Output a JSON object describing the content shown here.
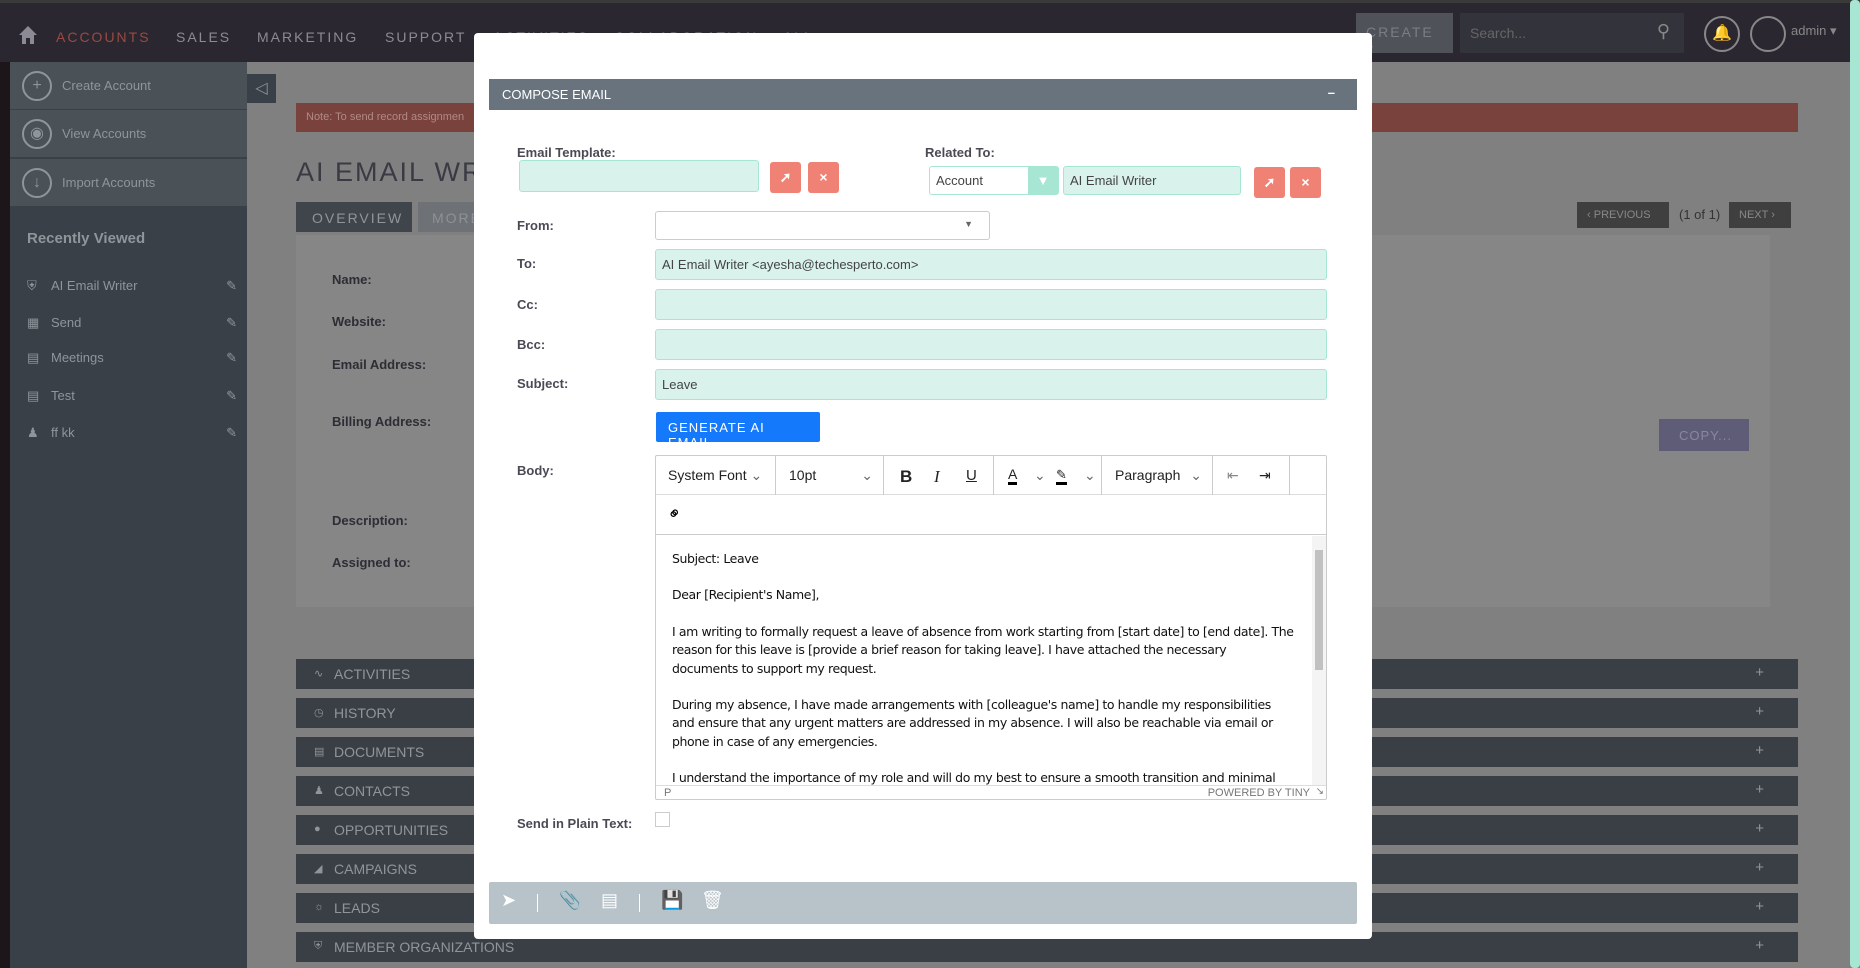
{
  "nav": {
    "items": [
      "ACCOUNTS",
      "SALES",
      "MARKETING",
      "SUPPORT",
      "ACTIVITIES",
      "COLLABORATION",
      "ALL"
    ],
    "create": "CREATE",
    "search_placeholder": "Search...",
    "user": "admin"
  },
  "sidebar": {
    "actions": [
      "Create Account",
      "View Accounts",
      "Import Accounts"
    ],
    "recent_title": "Recently Viewed",
    "recent": [
      "AI Email Writer",
      "Send",
      "Meetings",
      "Test",
      "ff kk"
    ]
  },
  "page": {
    "note": "Note: To send record assignmen",
    "title": "AI EMAIL WR",
    "tabs": [
      "OVERVIEW",
      "MORE"
    ],
    "labels": [
      "Name:",
      "Website:",
      "Email Address:",
      "Billing Address:",
      "Description:",
      "Assigned to:"
    ],
    "prev": "PREVIOUS",
    "count": "(1 of 1)",
    "next": "NEXT",
    "copy": "COPY...",
    "panels": [
      "ACTIVITIES",
      "HISTORY",
      "DOCUMENTS",
      "CONTACTS",
      "OPPORTUNITIES",
      "CAMPAIGNS",
      "LEADS",
      "MEMBER ORGANIZATIONS"
    ]
  },
  "modal": {
    "title": "COMPOSE EMAIL",
    "minimize": "–",
    "email_template_label": "Email Template:",
    "email_template_value": "",
    "related_label": "Related To:",
    "related_type": "Account",
    "related_value": "AI Email Writer",
    "from_label": "From:",
    "from_value": "",
    "to_label": "To:",
    "to_value": "AI Email Writer <ayesha@techesperto.com>",
    "cc_label": "Cc:",
    "cc_value": "",
    "bcc_label": "Bcc:",
    "bcc_value": "",
    "subject_label": "Subject:",
    "subject_value": "Leave",
    "generate": "GENERATE AI EMAIL",
    "body_label": "Body:",
    "plain_label": "Send in Plain Text:",
    "plain_checked": false,
    "editor": {
      "font": "System Font",
      "size": "10pt",
      "block": "Paragraph",
      "status_path": "P",
      "powered": "POWERED BY TINY",
      "paragraphs": [
        "Subject: Leave",
        "Dear [Recipient's Name],",
        "I am writing to formally request a leave of absence from work starting from [start date] to [end date]. The reason for this leave is [provide a brief reason for taking leave]. I have attached the necessary documents to support my request.",
        "During my absence, I have made arrangements with [colleague's name] to handle my responsibilities and ensure that any urgent matters are addressed in my absence. I will also be reachable via email or phone in case of any emergencies.",
        "I understand the importance of my role and will do my best to ensure a smooth transition and minimal"
      ]
    }
  },
  "colors": {
    "accent_red": "#f08275",
    "mint": "#d9f3ec",
    "blue": "#1479fb",
    "header": "#68737e"
  }
}
